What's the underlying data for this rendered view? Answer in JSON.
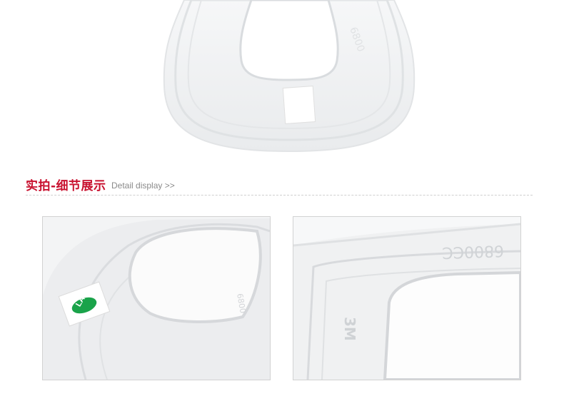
{
  "hero": {
    "image": "gasket-top-view"
  },
  "section": {
    "title": "实拍-细节展示",
    "subtitle": "Detail display >>"
  },
  "photos": [
    {
      "image": "gasket-detail-label",
      "label_text": "LA"
    },
    {
      "image": "gasket-detail-markings",
      "engraving_top": "6800CC",
      "engraving_side": "3M"
    }
  ],
  "colors": {
    "title": "#c8102e",
    "subtitle": "#8a8a8a",
    "label_green": "#1aa34a"
  }
}
